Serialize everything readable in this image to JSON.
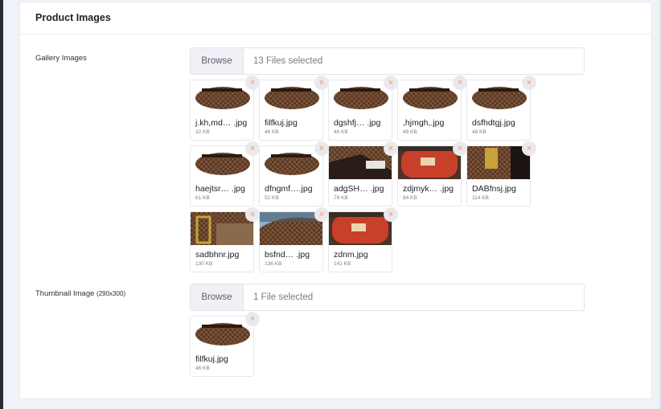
{
  "section_title": "Product Images",
  "gallery": {
    "label": "Gallery Images",
    "browse_label": "Browse",
    "status": "13 Files selected",
    "files": [
      {
        "name": "j.kh,md… .jpg",
        "size": "32 KB",
        "icon": "brown-bag-photo-icon"
      },
      {
        "name": "filfkuj.jpg",
        "size": "46 KB",
        "icon": "brown-bag-photo-icon"
      },
      {
        "name": "dgshfj… .jpg",
        "size": "46 KB",
        "icon": "brown-bag-photo-icon"
      },
      {
        "name": ",hjmgh,.jpg",
        "size": "49 KB",
        "icon": "brown-bag-photo-icon"
      },
      {
        "name": "dsfhdtgj.jpg",
        "size": "48 KB",
        "icon": "brown-bag-photo-icon"
      },
      {
        "name": "haejtsr… .jpg",
        "size": "61 KB",
        "icon": "brown-bag-photo-icon"
      },
      {
        "name": "dfngmf….jpg",
        "size": "52 KB",
        "icon": "brown-bag-photo-icon"
      },
      {
        "name": "adgSH… .jpg",
        "size": "78 KB",
        "icon": "bag-interior-photo-icon"
      },
      {
        "name": "zdjmyk… .jpg",
        "size": "84 KB",
        "icon": "red-lining-photo-icon"
      },
      {
        "name": "DABfnsj.jpg",
        "size": "114 KB",
        "icon": "bag-zipper-photo-icon"
      },
      {
        "name": "sadbhnr.jpg",
        "size": "130 KB",
        "icon": "bag-strap-photo-icon"
      },
      {
        "name": "bsfnd… .jpg",
        "size": "136 KB",
        "icon": "bag-fabric-photo-icon"
      },
      {
        "name": "zdnm.jpg",
        "size": "141 KB",
        "icon": "red-lining-photo-icon"
      }
    ]
  },
  "thumbnail": {
    "label": "Thumbnail Image",
    "label_hint": "(290x300)",
    "browse_label": "Browse",
    "status": "1 File selected",
    "files": [
      {
        "name": "filfkuj.jpg",
        "size": "46 KB",
        "icon": "brown-bag-photo-icon"
      }
    ]
  },
  "remove_glyph": "×",
  "colors": {
    "accent_remove": "#f09a5c",
    "bag_brown": "#5a3a28",
    "lining_red": "#c8402a"
  }
}
